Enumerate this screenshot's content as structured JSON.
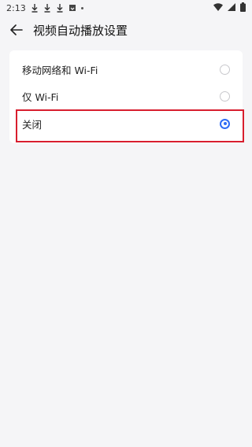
{
  "status": {
    "time": "2:13"
  },
  "header": {
    "title": "视频自动播放设置"
  },
  "options": [
    {
      "label": "移动网络和 Wi-Fi",
      "selected": false
    },
    {
      "label": "仅 Wi-Fi",
      "selected": false
    },
    {
      "label": "关闭",
      "selected": true
    }
  ],
  "colors": {
    "accent": "#2f6cf5",
    "highlight": "#d81e2e"
  }
}
